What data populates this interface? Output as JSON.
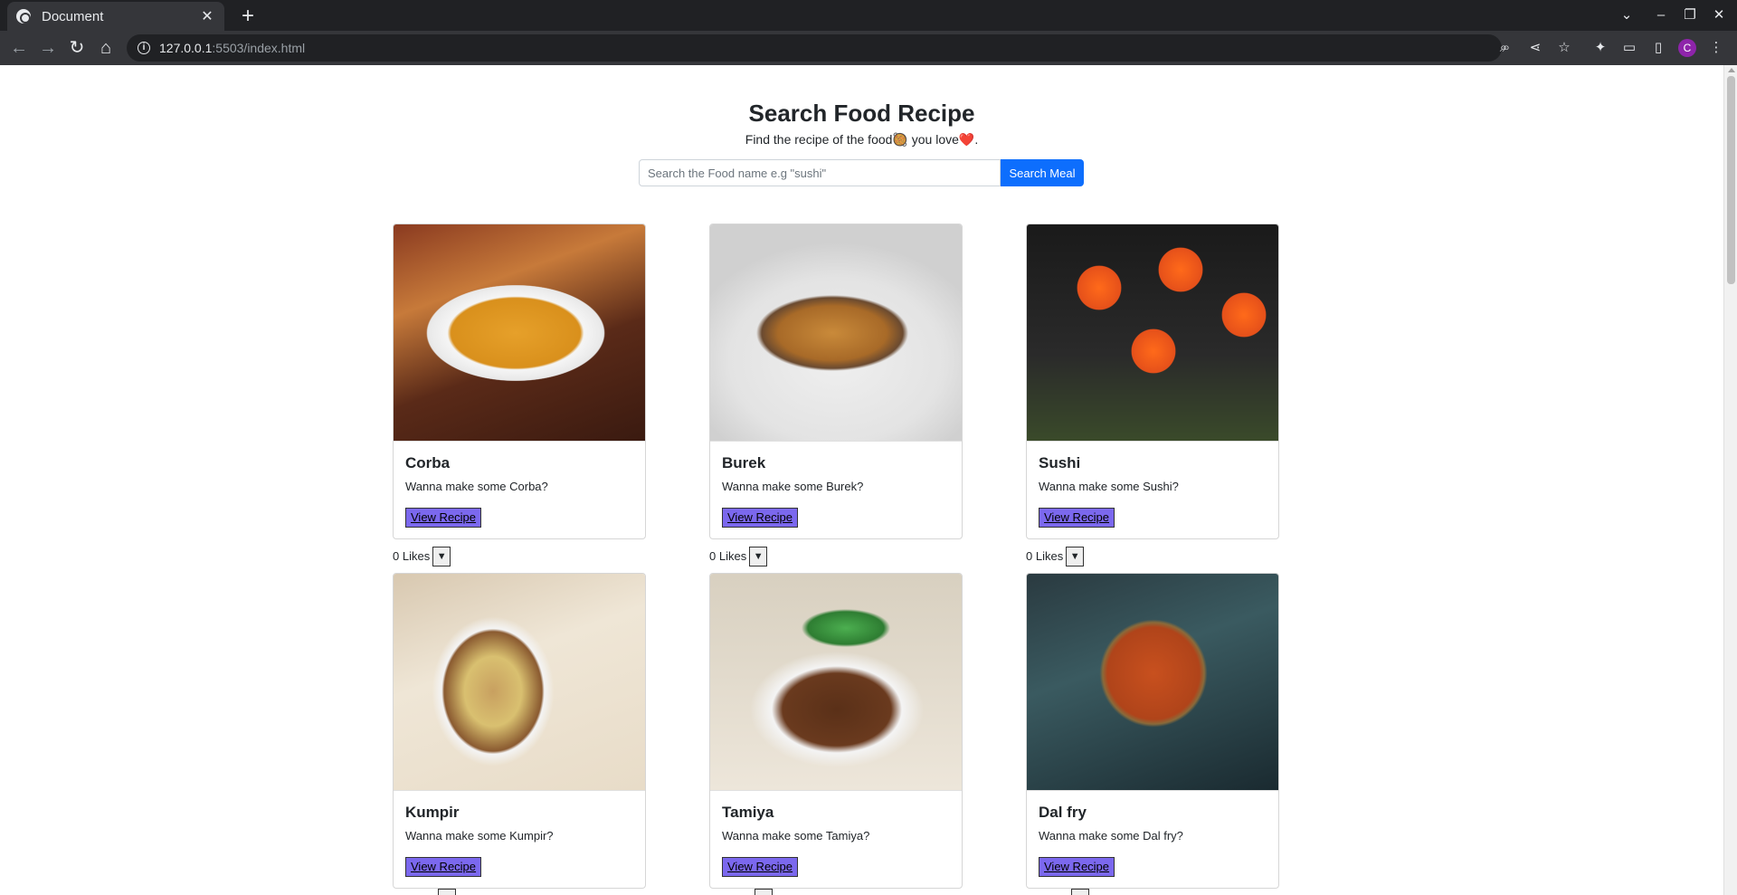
{
  "browser": {
    "tab_title": "Document",
    "url_host": "127.0.0.1",
    "url_path": ":5503/index.html",
    "profile_initial": "C"
  },
  "header": {
    "title": "Search Food Recipe",
    "subtitle": "Find the recipe of the food🥘 you love❤️."
  },
  "search": {
    "placeholder": "Search the Food name e.g \"sushi\"",
    "button_label": "Search Meal"
  },
  "meals": [
    {
      "name": "Corba",
      "desc": "Wanna make some Corba?",
      "button": "View Recipe",
      "likes": "0 Likes"
    },
    {
      "name": "Burek",
      "desc": "Wanna make some Burek?",
      "button": "View Recipe",
      "likes": "0 Likes"
    },
    {
      "name": "Sushi",
      "desc": "Wanna make some Sushi?",
      "button": "View Recipe",
      "likes": "0 Likes"
    },
    {
      "name": "Kumpir",
      "desc": "Wanna make some Kumpir?",
      "button": "View Recipe"
    },
    {
      "name": "Tamiya",
      "desc": "Wanna make some Tamiya?",
      "button": "View Recipe"
    },
    {
      "name": "Dal fry",
      "desc": "Wanna make some Dal fry?",
      "button": "View Recipe"
    }
  ],
  "like_icon": "▼",
  "colors": {
    "search_button": "#0d6efd",
    "view_recipe_button": "#7b68ee"
  }
}
